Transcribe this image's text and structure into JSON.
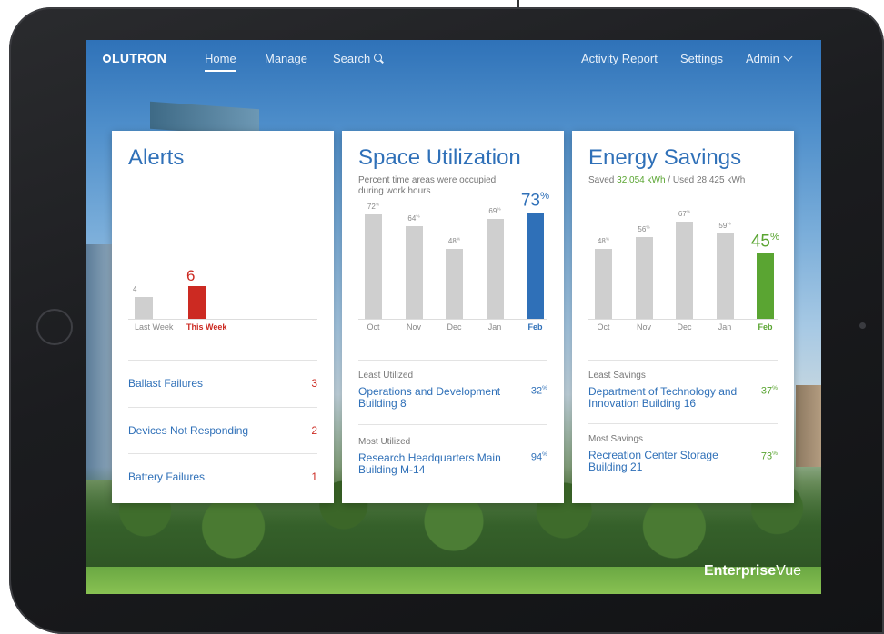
{
  "nav": {
    "logo": "LUTRON",
    "home": "Home",
    "manage": "Manage",
    "search": "Search",
    "activity": "Activity Report",
    "settings": "Settings",
    "admin": "Admin"
  },
  "brand": {
    "bold": "Enterprise",
    "regular": "Vue"
  },
  "alerts": {
    "title": "Alerts",
    "chart": [
      {
        "label": "Last Week",
        "value": 4
      },
      {
        "label": "This Week",
        "value": 6
      }
    ],
    "items": [
      {
        "name": "Ballast Failures",
        "count": "3"
      },
      {
        "name": "Devices Not Responding",
        "count": "2"
      },
      {
        "name": "Battery Failures",
        "count": "1"
      }
    ]
  },
  "space": {
    "title": "Space Utilization",
    "subtitle_line1": "Percent time areas were occupied",
    "subtitle_line2": "during work hours",
    "least_label": "Least Utilized",
    "least_name": "Operations and Development Building 8",
    "least_pct": "32",
    "most_label": "Most Utilized",
    "most_name": "Research Headquarters Main Building M-14",
    "most_pct": "94"
  },
  "energy": {
    "title": "Energy Savings",
    "saved_prefix": "Saved ",
    "saved_value": "32,054 kWh",
    "used_text": " / Used 28,425 kWh",
    "least_label": "Least Savings",
    "least_name": "Department of Technology and Innovation Building 16",
    "least_pct": "37",
    "most_label": "Most Savings",
    "most_name": "Recreation Center Storage Building 21",
    "most_pct": "73"
  },
  "colors": {
    "blue": "#2f70b8",
    "green": "#5aa532",
    "red": "#cc2a22",
    "grey": "#cfcfcf"
  },
  "chart_data": [
    {
      "type": "bar",
      "categories": [
        "Last Week",
        "This Week"
      ],
      "values": [
        4,
        6
      ],
      "title": "Alerts"
    },
    {
      "type": "bar",
      "categories": [
        "Oct",
        "Nov",
        "Dec",
        "Jan",
        "Feb"
      ],
      "values": [
        72,
        64,
        48,
        69,
        73
      ],
      "unit": "%",
      "title": "Space Utilization",
      "ylim": [
        0,
        100
      ]
    },
    {
      "type": "bar",
      "categories": [
        "Oct",
        "Nov",
        "Dec",
        "Jan",
        "Feb"
      ],
      "values": [
        48,
        56,
        67,
        59,
        45
      ],
      "unit": "%",
      "title": "Energy Savings",
      "ylim": [
        0,
        100
      ]
    }
  ]
}
